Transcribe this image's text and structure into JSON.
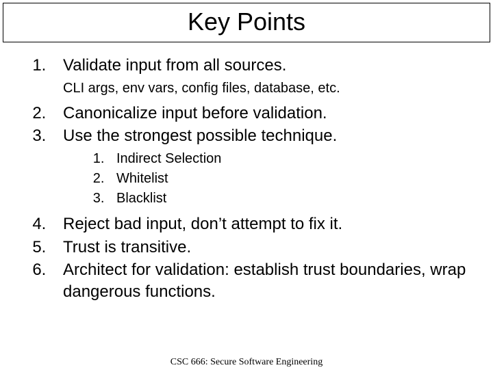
{
  "title": "Key Points",
  "items": {
    "p1": "Validate input from all sources.",
    "p1_desc": "CLI args, env vars, config files, database, etc.",
    "p2": "Canonicalize input before validation.",
    "p3": "Use the strongest possible technique.",
    "p3_sub": {
      "s1": "Indirect Selection",
      "s2": "Whitelist",
      "s3": "Blacklist"
    },
    "p4": "Reject bad input, don’t attempt to fix it.",
    "p5": "Trust is transitive.",
    "p6": "Architect for validation: establish trust boundaries, wrap dangerous functions."
  },
  "footer": "CSC 666: Secure Software Engineering"
}
